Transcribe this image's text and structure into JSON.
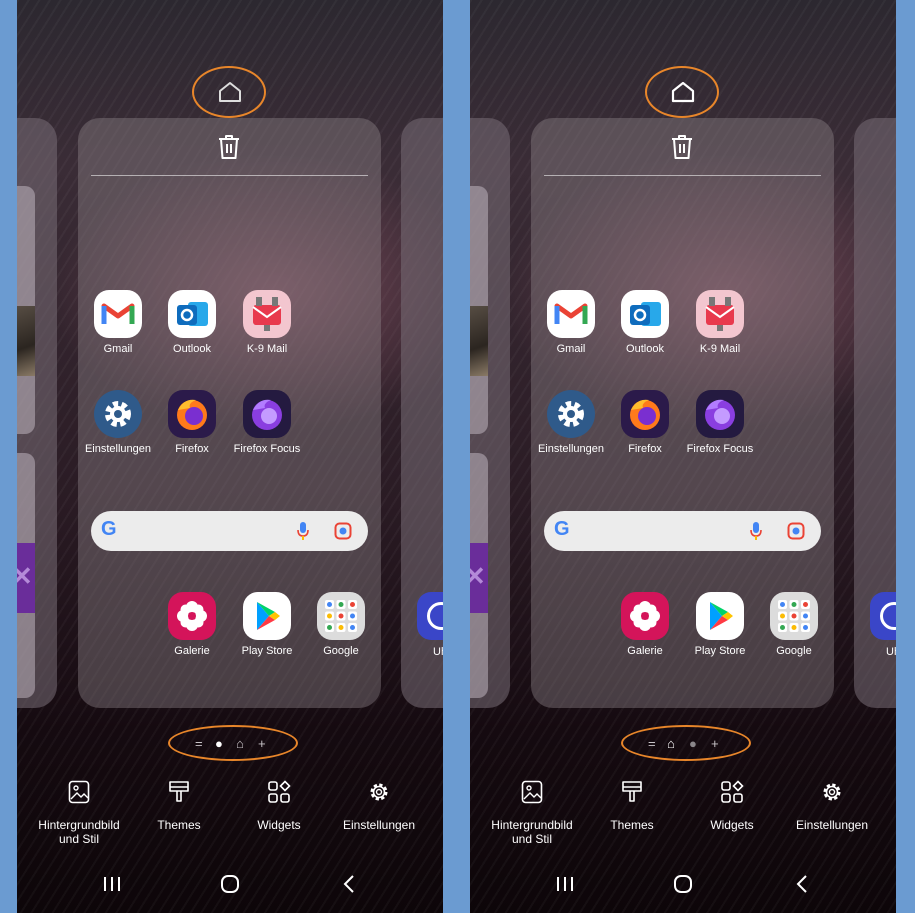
{
  "screens": [
    {
      "home_icon": "home-icon",
      "trash_icon": "trash-icon",
      "apps_row1": [
        {
          "label": "Gmail",
          "icon": "gmail-icon"
        },
        {
          "label": "Outlook",
          "icon": "outlook-icon"
        },
        {
          "label": "K-9 Mail",
          "icon": "k9-mail-icon"
        }
      ],
      "apps_row2": [
        {
          "label": "Einstellungen",
          "icon": "settings-gear-icon"
        },
        {
          "label": "Firefox",
          "icon": "firefox-icon"
        },
        {
          "label": "Firefox Focus",
          "icon": "firefox-focus-icon"
        }
      ],
      "apps_row3": [
        {
          "label": "Galerie",
          "icon": "gallery-icon"
        },
        {
          "label": "Play Store",
          "icon": "play-store-icon"
        },
        {
          "label": "Google",
          "icon": "google-folder-icon"
        }
      ],
      "peek_label": "Uh",
      "page_indicators": {
        "list": "=",
        "dot1": "●",
        "dot2": "⌂",
        "add": "+"
      },
      "toolbar": {
        "wallpaper": "Hintergrundbild und Stil",
        "themes": "Themes",
        "widgets": "Widgets",
        "settings": "Einstellungen"
      }
    },
    {
      "home_icon": "home-icon",
      "trash_icon": "trash-icon",
      "apps_row1": [
        {
          "label": "Gmail",
          "icon": "gmail-icon"
        },
        {
          "label": "Outlook",
          "icon": "outlook-icon"
        },
        {
          "label": "K-9 Mail",
          "icon": "k9-mail-icon"
        }
      ],
      "apps_row2": [
        {
          "label": "Einstellungen",
          "icon": "settings-gear-icon"
        },
        {
          "label": "Firefox",
          "icon": "firefox-icon"
        },
        {
          "label": "Firefox Focus",
          "icon": "firefox-focus-icon"
        }
      ],
      "apps_row3": [
        {
          "label": "Galerie",
          "icon": "gallery-icon"
        },
        {
          "label": "Play Store",
          "icon": "play-store-icon"
        },
        {
          "label": "Google",
          "icon": "google-folder-icon"
        }
      ],
      "peek_label": "Uh",
      "page_indicators": {
        "list": "=",
        "dot1": "⌂",
        "dot2": "●",
        "add": "+"
      },
      "toolbar": {
        "wallpaper": "Hintergrundbild und Stil",
        "themes": "Themes",
        "widgets": "Widgets",
        "settings": "Einstellungen"
      }
    }
  ],
  "colors": {
    "highlight": "#e8862a",
    "background": "#6b9bd1"
  },
  "google_logo": "G"
}
